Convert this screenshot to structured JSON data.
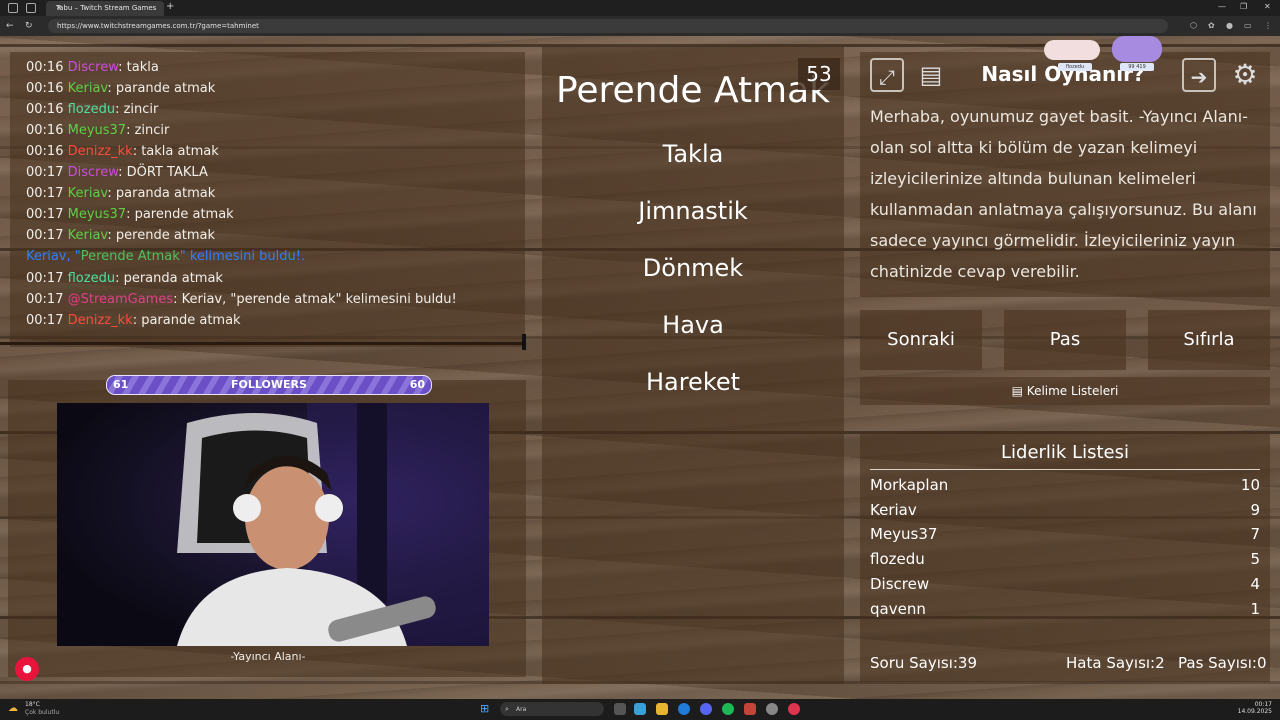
{
  "browser": {
    "tab_title": "Tabu – Twitch Stream Games",
    "url": "https://www.twitchstreamgames.com.tr/?game=tahminet"
  },
  "chat": {
    "lines": [
      {
        "time": "00:16",
        "user": "Discrew",
        "msg": ": takla",
        "color": "#d04be0"
      },
      {
        "time": "00:16",
        "user": "Keriav",
        "msg": ": parande atmak",
        "color": "#5fd046"
      },
      {
        "time": "00:16",
        "user": "flozedu",
        "msg": ": zincir",
        "color": "#4fe0a0"
      },
      {
        "time": "00:16",
        "user": "Meyus37",
        "msg": ": zincir",
        "color": "#5fd046"
      },
      {
        "time": "00:16",
        "user": "Denizz_kk",
        "msg": ": takla atmak",
        "color": "#ff4b3b"
      },
      {
        "time": "00:17",
        "user": "Discrew",
        "msg": ": DÖRT TAKLA",
        "color": "#d04be0"
      },
      {
        "time": "00:17",
        "user": "Keriav",
        "msg": ": paranda atmak",
        "color": "#5fd046"
      },
      {
        "time": "00:17",
        "user": "Meyus37",
        "msg": ": parende atmak",
        "color": "#5fd046"
      },
      {
        "time": "00:17",
        "user": "Keriav",
        "msg": ": perende atmak",
        "color": "#5fd046"
      },
      {
        "time": "00:17",
        "user": "flozedu",
        "msg": ": peranda atmak",
        "color": "#4fe0a0"
      },
      {
        "time": "00:17",
        "user": "@StreamGames",
        "msg": ": Keriav, \"perende atmak\" kelimesini buldu!",
        "color": "#e0408a"
      },
      {
        "time": "00:17",
        "user": "Denizz_kk",
        "msg": ": parande atmak",
        "color": "#ff4b3b"
      }
    ],
    "system_prefix": "Keriav, \"",
    "system_word": "Perende Atmak",
    "system_suffix": "\" kelimesini buldu!."
  },
  "followers": {
    "left": "61",
    "label": "FOLLOWERS",
    "right": "60"
  },
  "webcam": {
    "caption": "-Yayıncı Alanı-"
  },
  "card": {
    "main_word": "Perende Atmak",
    "timer": "53",
    "forbidden": [
      "Takla",
      "Jimnastik",
      "Dönmek",
      "Hava",
      "Hareket"
    ]
  },
  "how": {
    "title": "Nasıl Oynanır?",
    "text": "Merhaba, oyunumuz gayet basit. -Yayıncı Alanı- olan sol altta ki bölüm de yazan kelimeyi izleyicilerinize altında bulunan kelimeleri kullanmadan anlatmaya çalışıyorsunuz. Bu alanı sadece yayıncı görmelidir. İzleyicileriniz yayın chatinizde cevap verebilir."
  },
  "buttons": {
    "next": "Sonraki",
    "pass": "Pas",
    "reset": "Sıfırla",
    "lists": "Kelime Listeleri"
  },
  "leaderboard": {
    "title": "Liderlik Listesi",
    "rows": [
      {
        "name": "Morkaplan",
        "score": "10"
      },
      {
        "name": "Keriav",
        "score": "9"
      },
      {
        "name": "Meyus37",
        "score": "7"
      },
      {
        "name": "flozedu",
        "score": "5"
      },
      {
        "name": "Discrew",
        "score": "4"
      },
      {
        "name": "qavenn",
        "score": "1"
      }
    ]
  },
  "stats": {
    "questions": "Soru Sayısı:39",
    "errors": "Hata Sayısı:2",
    "passes": "Pas Sayısı:0"
  },
  "overlay": {
    "tag1": "flozedu",
    "tag2": "99 419"
  },
  "taskbar": {
    "weather": "18°C",
    "weather_desc": "Çok bulutlu",
    "search": "Ara",
    "time": "00:17",
    "date": "14.09.2025"
  }
}
